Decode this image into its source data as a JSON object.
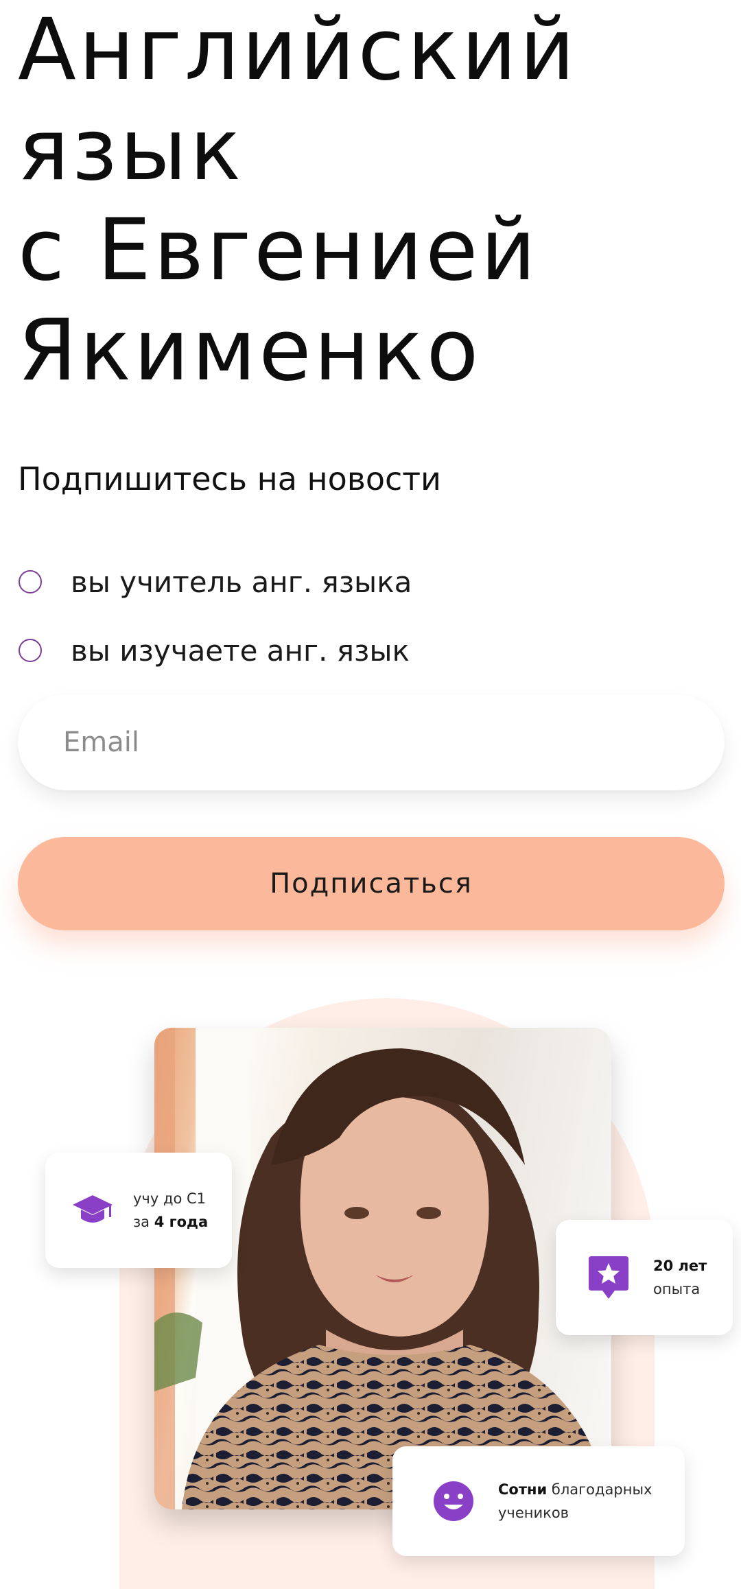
{
  "hero": {
    "title_lines": [
      "Английский",
      "язык",
      "с Евгенией",
      "Якименко"
    ]
  },
  "subscribe": {
    "heading": "Подпишитесь на новости",
    "options": [
      {
        "label": "вы учитель анг. языка",
        "selected": false
      },
      {
        "label": "вы изучаете анг. язык",
        "selected": false
      }
    ],
    "email_placeholder": "Email",
    "email_value": "",
    "button_label": "Подписаться"
  },
  "colors": {
    "accent": "#7b3d96",
    "icon_purple": "#8a3fc7",
    "button_bg": "#fcb89a",
    "circle_bg": "#ffeee7"
  },
  "cards": {
    "teach": {
      "icon": "graduation-cap-icon",
      "line1": "учу до С1",
      "line2_prefix": "за ",
      "line2_bold": "4 года"
    },
    "years": {
      "icon": "star-badge-icon",
      "line1_bold": "20 лет",
      "line2": "опыта"
    },
    "students": {
      "icon": "smiley-icon",
      "line1_bold": "Сотни",
      "line1_rest": " благодарных",
      "line2": "учеников"
    }
  }
}
